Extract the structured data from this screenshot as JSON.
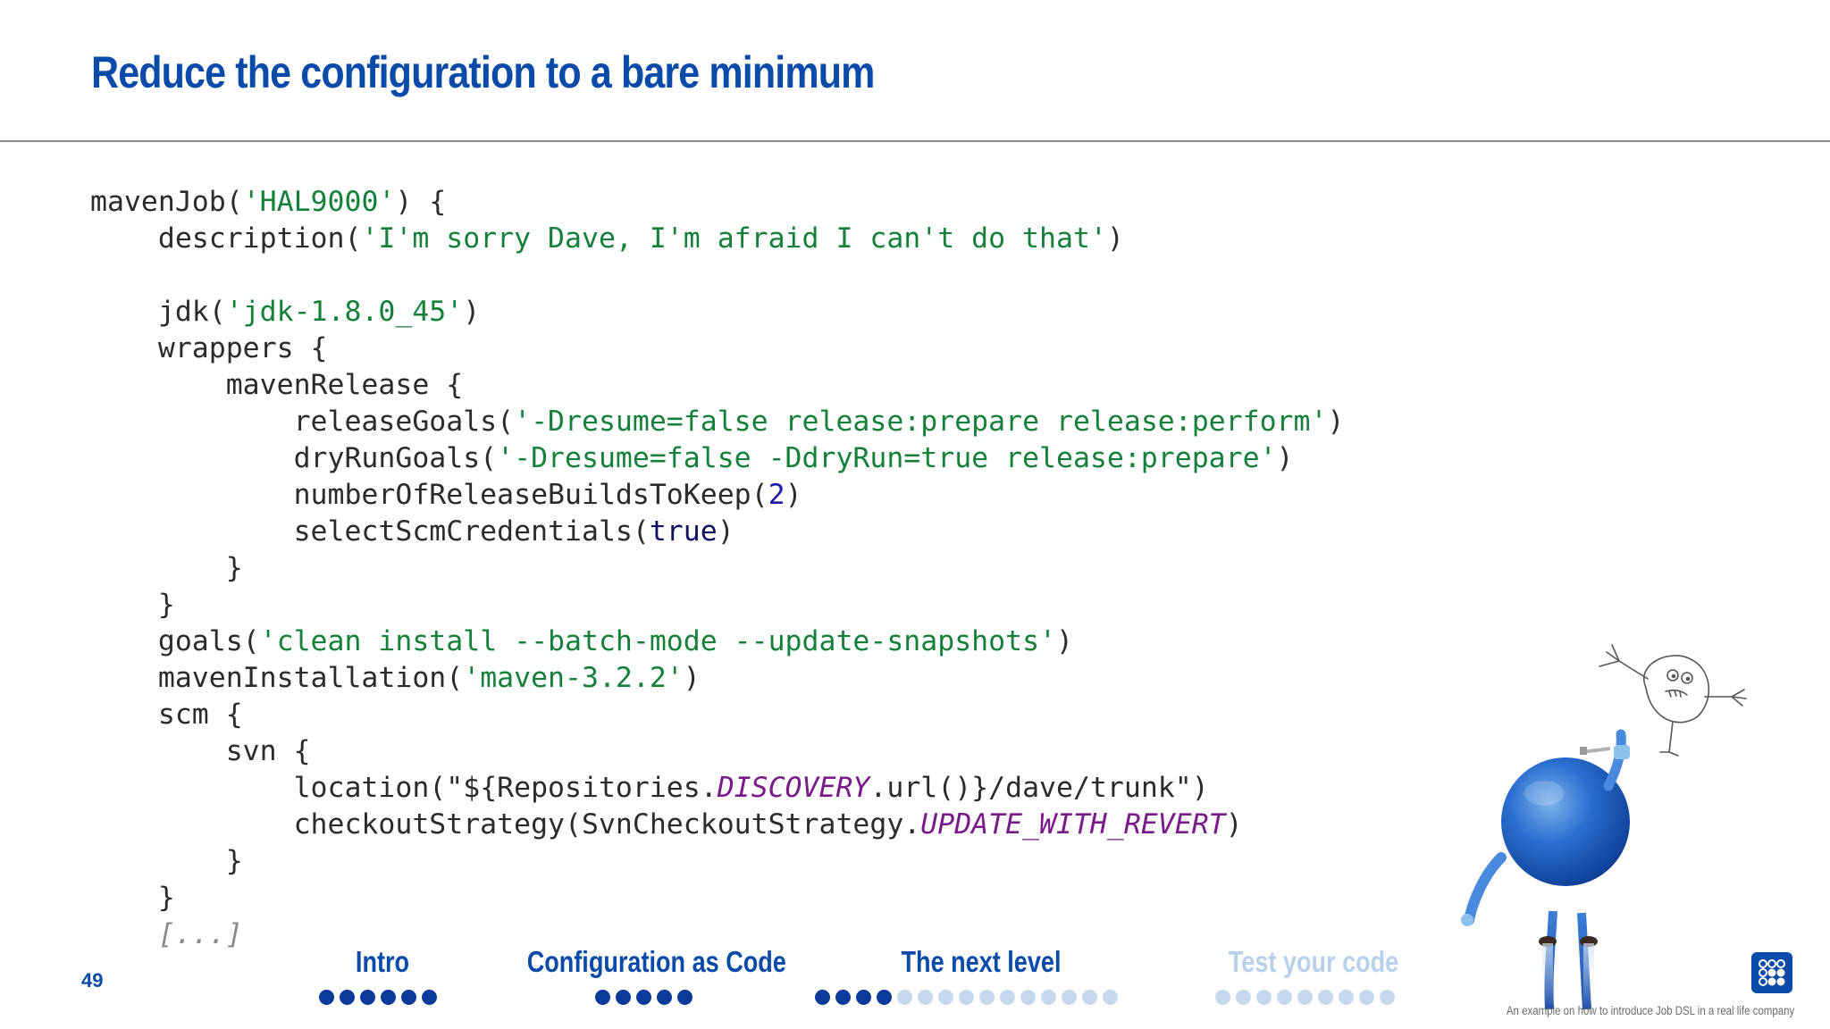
{
  "slide": {
    "title": "Reduce the configuration to a bare minimum",
    "page_number": "49",
    "footer": "An example on how to introduce Job DSL in a real life company"
  },
  "code": {
    "l01a": "mavenJob(",
    "l01b": "'HAL9000'",
    "l01c": ") {",
    "l02a": "    description(",
    "l02b": "'I'm sorry Dave, I'm afraid I can't do that'",
    "l02c": ")",
    "l03": "",
    "l04a": "    jdk(",
    "l04b": "'jdk-1.8.0_45'",
    "l04c": ")",
    "l05": "    wrappers {",
    "l06": "        mavenRelease {",
    "l07a": "            releaseGoals(",
    "l07b": "'-Dresume=false release:prepare release:perform'",
    "l07c": ")",
    "l08a": "            dryRunGoals(",
    "l08b": "'-Dresume=false -DdryRun=true release:prepare'",
    "l08c": ")",
    "l09a": "            numberOfReleaseBuildsToKeep(",
    "l09b": "2",
    "l09c": ")",
    "l10a": "            selectScmCredentials(",
    "l10b": "true",
    "l10c": ")",
    "l11": "        }",
    "l12": "    }",
    "l13a": "    goals(",
    "l13b": "'clean install --batch-mode --update-snapshots'",
    "l13c": ")",
    "l14a": "    mavenInstallation(",
    "l14b": "'maven-3.2.2'",
    "l14c": ")",
    "l15": "    scm {",
    "l16": "        svn {",
    "l17a": "            location(",
    "l17b": "\"${Repositories.",
    "l17c": "DISCOVERY",
    "l17d": ".url()}/dave/trunk\"",
    "l17e": ")",
    "l18a": "            checkoutStrategy(SvnCheckoutStrategy.",
    "l18b": "UPDATE_WITH_REVERT",
    "l18c": ")",
    "l19": "        }",
    "l20": "    }",
    "l21a": "    ",
    "l21b": "[...]"
  },
  "nav": {
    "sections": [
      {
        "label": "Intro",
        "dots_filled": 6,
        "dots_total": 6,
        "state": "visited"
      },
      {
        "label": "Configuration as Code",
        "dots_filled": 5,
        "dots_total": 5,
        "state": "visited"
      },
      {
        "label": "The next level",
        "dots_filled": 4,
        "dots_total": 15,
        "state": "current"
      },
      {
        "label": "Test your code",
        "dots_filled": 0,
        "dots_total": 9,
        "state": "upcoming"
      }
    ]
  },
  "colors": {
    "brand_blue": "#0a4aa8",
    "string_green": "#16803a",
    "dot_dark": "#0a3a9a",
    "dot_light": "#c6d8ee"
  },
  "icons": {
    "logo": "company-logo-icon",
    "mascot": "blue-ball-mascot-icon",
    "doodle": "sketch-creature-icon"
  }
}
